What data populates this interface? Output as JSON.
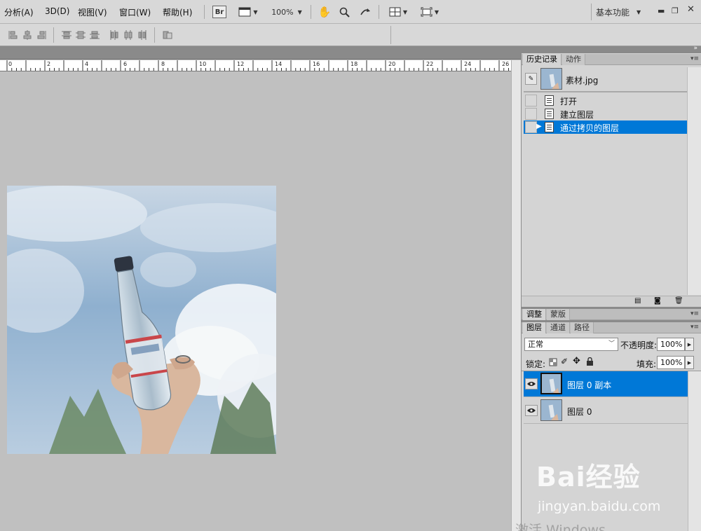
{
  "menu": {
    "items": [
      "分析(A)",
      "3D(D)",
      "视图(V)",
      "窗口(W)",
      "帮助(H)"
    ],
    "br_label": "Br",
    "zoom": "100%",
    "workspace": "基本功能"
  },
  "ruler": {
    "labels": [
      "0",
      "2",
      "4",
      "6",
      "8",
      "10",
      "12",
      "14",
      "16",
      "18",
      "20",
      "22",
      "24",
      "26"
    ]
  },
  "history_panel": {
    "tabs": [
      "历史记录",
      "动作"
    ],
    "snapshot_name": "素材.jpg",
    "steps": [
      "打开",
      "建立图层",
      "通过拷贝的图层"
    ],
    "selected_index": 2
  },
  "adjust_panel": {
    "tabs": [
      "调整",
      "蒙版"
    ]
  },
  "layers_panel": {
    "tabs": [
      "图层",
      "通道",
      "路径"
    ],
    "blend_mode": "正常",
    "opacity_label": "不透明度:",
    "opacity": "100%",
    "lock_label": "锁定:",
    "fill_label": "填充:",
    "fill": "100%",
    "layers": [
      {
        "name": "图层 0 副本",
        "selected": true
      },
      {
        "name": "图层 0",
        "selected": false
      }
    ]
  },
  "watermark": {
    "logo_text": "Bai经验",
    "url": "jingyan.baidu.com"
  },
  "os_notice": "激活 Windows",
  "colors": {
    "selection": "#0078d7",
    "canvas_bg": "#c0c0c0",
    "panel_bg": "#d4d4d4"
  }
}
